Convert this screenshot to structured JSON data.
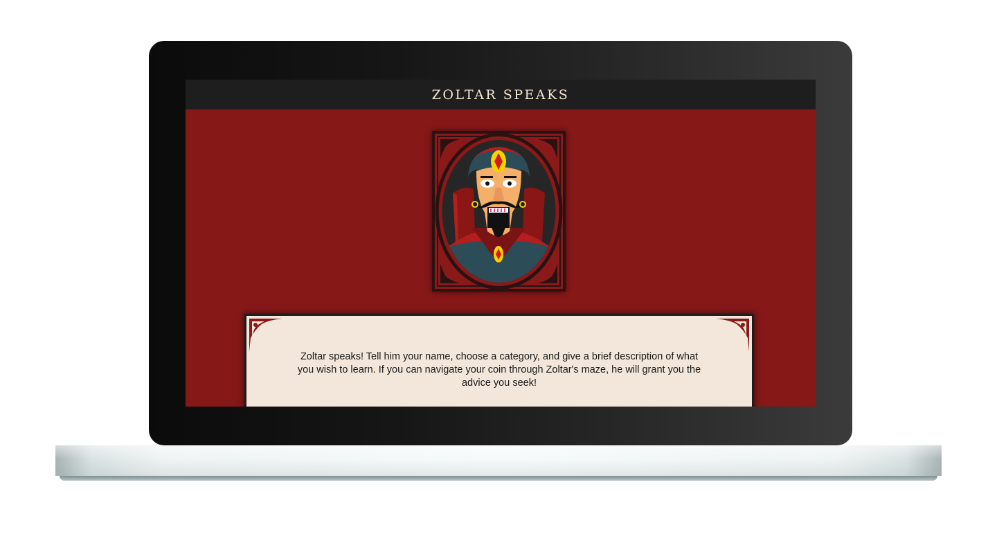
{
  "header": {
    "title": "ZOLTAR SPEAKS"
  },
  "portrait": {
    "icon": "zoltar-portrait-icon"
  },
  "intro": {
    "text": "Zoltar speaks! Tell him your name, choose a category, and give a brief description of what you wish to learn. If you can navigate your coin through Zoltar's maze, he will grant you the advice you seek!"
  },
  "colors": {
    "page_background": "#861818",
    "header_background": "#1e1e1e",
    "card_background": "#f2e7da",
    "title_text": "#f3e6d3"
  }
}
